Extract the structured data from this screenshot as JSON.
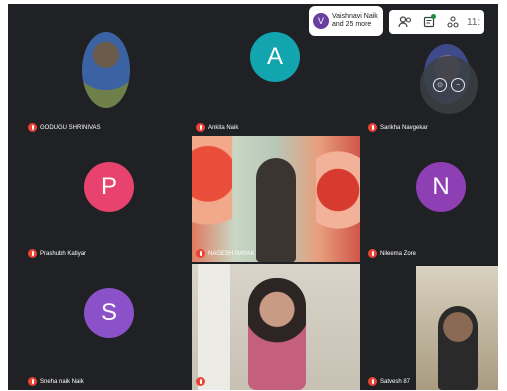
{
  "notification": {
    "avatar_letter": "V",
    "text_line1": "Vaishnavi Naik",
    "text_line2": "and 25 more"
  },
  "toolbar": {
    "icons": [
      "people-icon",
      "chat-icon",
      "activities-icon"
    ],
    "clock": "11:"
  },
  "participants": [
    {
      "name": "GODUGU SHRINIVAS",
      "type": "photo"
    },
    {
      "name": "Ankita Naik",
      "letter": "A",
      "color": "#12a4af"
    },
    {
      "name": "Sarikha Navgekar",
      "type": "photo"
    },
    {
      "name": "Prashubh Katiyar",
      "letter": "P",
      "color": "#e8436e"
    },
    {
      "name": "NAGESH NAYAK",
      "type": "video"
    },
    {
      "name": "Nileema Zore",
      "letter": "N",
      "color": "#8e3fb3"
    },
    {
      "name": "Sneha naik Naik",
      "letter": "S",
      "color": "#8a51c8"
    },
    {
      "name": "",
      "type": "video"
    },
    {
      "name": "Satvesh 87",
      "type": "video"
    }
  ]
}
